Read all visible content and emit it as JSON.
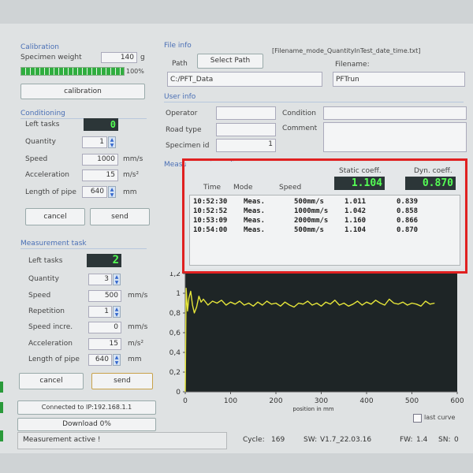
{
  "calibration": {
    "title": "Calibration",
    "specimen_weight_label": "Specimen weight",
    "specimen_weight_value": "140",
    "specimen_weight_unit": "g",
    "progress_percent": 100,
    "progress_text": "100%",
    "button": "calibration"
  },
  "conditioning": {
    "title": "Conditioning",
    "left_tasks_label": "Left tasks",
    "left_tasks_value": "0",
    "quantity_label": "Quantity",
    "quantity_value": "1",
    "speed_label": "Speed",
    "speed_value": "1000",
    "speed_unit": "mm/s",
    "accel_label": "Acceleration",
    "accel_value": "15",
    "accel_unit": "m/s²",
    "pipe_label": "Length of pipe",
    "pipe_value": "640",
    "pipe_unit": "mm",
    "cancel": "cancel",
    "send": "send"
  },
  "measurement": {
    "title": "Measurement task",
    "left_tasks_label": "Left tasks",
    "left_tasks_value": "2",
    "quantity_label": "Quantity",
    "quantity_value": "3",
    "speed_label": "Speed",
    "speed_value": "500",
    "speed_unit": "mm/s",
    "repetition_label": "Repetition",
    "repetition_value": "1",
    "speed_incr_label": "Speed incre.",
    "speed_incr_value": "0",
    "speed_incr_unit": "mm/s",
    "accel_label": "Acceleration",
    "accel_value": "15",
    "accel_unit": "m/s²",
    "pipe_label": "Length of pipe",
    "pipe_value": "640",
    "pipe_unit": "mm",
    "cancel": "cancel",
    "send": "send"
  },
  "connection": "Connected to IP:192.168.1.1",
  "download": "Download 0%",
  "file_info": {
    "title": "File info",
    "path_label": "Path",
    "select_path": "Select Path",
    "filename_format": "[Filename_mode_QuantityInTest_date_time.txt]",
    "filename_label": "Filename:",
    "path_value": "C:/PFT_Data",
    "filename_value": "PFTrun"
  },
  "user_info": {
    "title": "User info",
    "operator_label": "Operator",
    "condition_label": "Condition",
    "road_type_label": "Road type",
    "comment_label": "Comment",
    "specimen_id_label": "Specimen id",
    "specimen_id_value": "1"
  },
  "results": {
    "title": "Measurement results",
    "static_label": "Static coeff.",
    "dyn_label": "Dyn. coeff.",
    "static_value": "1.104",
    "dyn_value": "0.870",
    "col_time": "Time",
    "col_mode": "Mode",
    "col_speed": "Speed",
    "rows": [
      {
        "time": "10:52:30",
        "mode": "Meas.",
        "speed": "500mm/s",
        "static": "1.011",
        "dyn": "0.839"
      },
      {
        "time": "10:52:52",
        "mode": "Meas.",
        "speed": "1000mm/s",
        "static": "1.042",
        "dyn": "0.858"
      },
      {
        "time": "10:53:09",
        "mode": "Meas.",
        "speed": "2000mm/s",
        "static": "1.160",
        "dyn": "0.866"
      },
      {
        "time": "10:54:00",
        "mode": "Meas.",
        "speed": "500mm/s",
        "static": "1.104",
        "dyn": "0.870"
      }
    ]
  },
  "highlight_color": "#e02020",
  "chart_data": {
    "type": "line",
    "xlabel": "position in mm",
    "ylabel": "",
    "xlim": [
      0,
      600
    ],
    "ylim": [
      0,
      1.2
    ],
    "x_ticks": [
      "0",
      "100",
      "200",
      "300",
      "400",
      "500",
      "600"
    ],
    "y_ticks": [
      "0",
      "0,2",
      "0,4",
      "0,6",
      "0,8",
      "1",
      "1,2"
    ],
    "line_color": "#e6e63a",
    "background": "#1e2526",
    "series": [
      {
        "x": [
          0,
          2,
          5,
          8,
          12,
          16,
          20,
          25,
          30,
          35,
          40,
          50,
          60,
          70,
          80,
          90,
          100,
          110,
          120,
          130,
          140,
          150,
          160,
          170,
          180,
          190,
          200,
          210,
          220,
          230,
          240,
          250,
          260,
          270,
          280,
          290,
          300,
          310,
          320,
          330,
          340,
          350,
          360,
          370,
          380,
          390,
          400,
          410,
          420,
          430,
          440,
          450,
          460,
          470,
          480,
          490,
          500,
          510,
          520,
          530,
          540,
          550
        ],
        "y": [
          0.0,
          1.05,
          0.82,
          0.95,
          1.02,
          0.88,
          0.8,
          0.86,
          0.97,
          0.91,
          0.94,
          0.88,
          0.92,
          0.9,
          0.93,
          0.88,
          0.91,
          0.89,
          0.92,
          0.88,
          0.9,
          0.87,
          0.91,
          0.88,
          0.92,
          0.89,
          0.9,
          0.87,
          0.91,
          0.88,
          0.86,
          0.9,
          0.89,
          0.92,
          0.88,
          0.9,
          0.87,
          0.91,
          0.89,
          0.93,
          0.88,
          0.9,
          0.87,
          0.89,
          0.92,
          0.88,
          0.91,
          0.89,
          0.93,
          0.9,
          0.88,
          0.94,
          0.9,
          0.89,
          0.91,
          0.88,
          0.9,
          0.89,
          0.87,
          0.92,
          0.89,
          0.9
        ]
      }
    ]
  },
  "last_curve_label": "last curve",
  "status": {
    "message": "Measurement active !",
    "cycle_label": "Cycle:",
    "cycle_value": "169",
    "sw_label": "SW:",
    "sw_value": "V1.7_22.03.16",
    "fw_label": "FW:",
    "fw_value": "1.4",
    "sn_label": "SN:",
    "sn_value": "0"
  }
}
